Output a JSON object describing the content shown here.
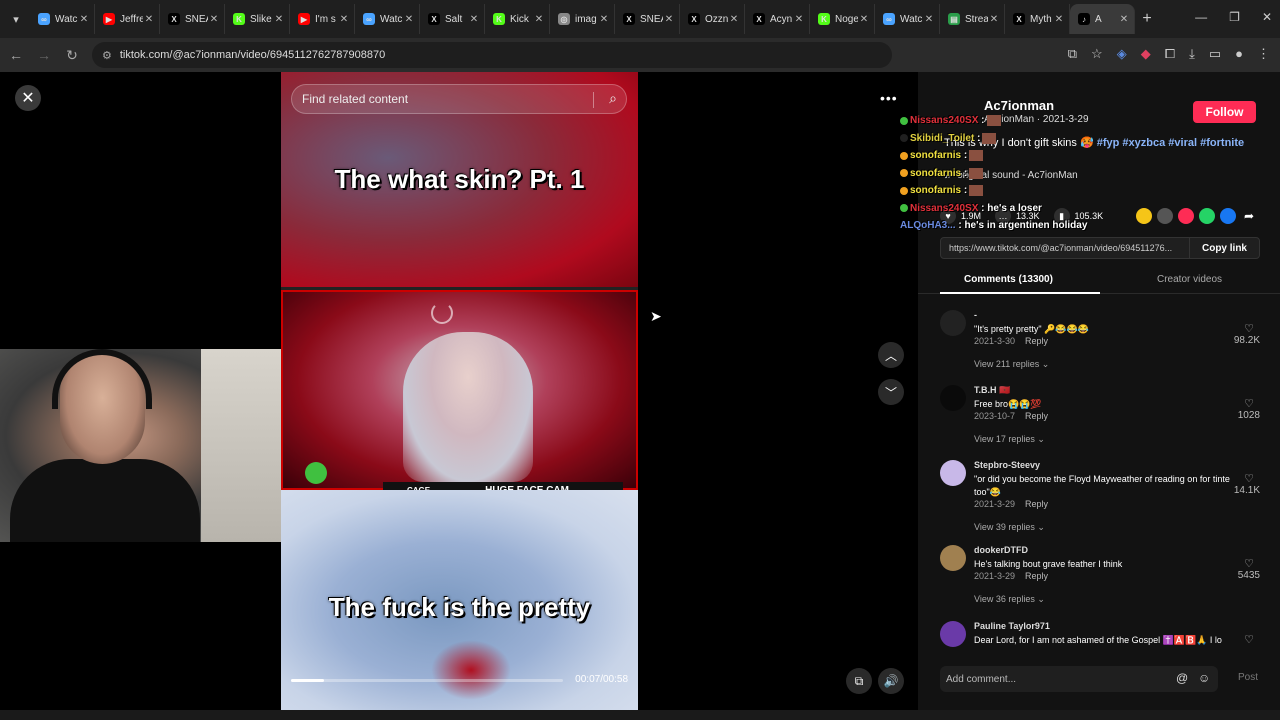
{
  "browser": {
    "tabs": [
      {
        "label": "Watc",
        "fav_color": "#4aa3ff",
        "fav_glyph": "∞"
      },
      {
        "label": "Jeffre",
        "fav_color": "#ff0000",
        "fav_glyph": "▶"
      },
      {
        "label": "SNEA",
        "fav_color": "#000000",
        "fav_glyph": "X"
      },
      {
        "label": "Slike",
        "fav_color": "#53fc18",
        "fav_glyph": "K"
      },
      {
        "label": "I'm s",
        "fav_color": "#ff0000",
        "fav_glyph": "▶"
      },
      {
        "label": "Watc",
        "fav_color": "#4aa3ff",
        "fav_glyph": "∞"
      },
      {
        "label": "Salt",
        "fav_color": "#000000",
        "fav_glyph": "X"
      },
      {
        "label": "Kick",
        "fav_color": "#53fc18",
        "fav_glyph": "K"
      },
      {
        "label": "imag",
        "fav_color": "#888888",
        "fav_glyph": "◎"
      },
      {
        "label": "SNEA",
        "fav_color": "#000000",
        "fav_glyph": "X"
      },
      {
        "label": "Ozzn",
        "fav_color": "#000000",
        "fav_glyph": "X"
      },
      {
        "label": "Acyn",
        "fav_color": "#000000",
        "fav_glyph": "X"
      },
      {
        "label": "Noge",
        "fav_color": "#53fc18",
        "fav_glyph": "K"
      },
      {
        "label": "Watc",
        "fav_color": "#4aa3ff",
        "fav_glyph": "∞"
      },
      {
        "label": "Strea",
        "fav_color": "#2a9d4a",
        "fav_glyph": "▤"
      },
      {
        "label": "Myth",
        "fav_color": "#000000",
        "fav_glyph": "X"
      },
      {
        "label": "A",
        "fav_color": "#000000",
        "fav_glyph": "♪"
      }
    ],
    "url": "tiktok.com/@ac7ionman/video/6945112762787908870"
  },
  "video": {
    "search_placeholder": "Find related content",
    "caption_top": "The what skin? Pt. 1",
    "caption_bottom": "The fuck is the pretty",
    "facecam_label": "HUGE FACE CAM",
    "cage_label": "CAGE",
    "time": "00:07/00:58",
    "progress": 0.12
  },
  "panel": {
    "author_name": "Ac7ionman",
    "author_sub": "Ac7ionMan · 2021-3-29",
    "follow_label": "Follow",
    "desc_text": "This is why I don't gift skins 🥵",
    "desc_tags": [
      "#fyp",
      "#xyzbca",
      "#viral",
      "#fortnite"
    ],
    "sound": "original sound - Ac7ionMan",
    "stats": {
      "likes": "1.9M",
      "comments": "13.3K",
      "saves": "105.3K"
    },
    "share_colors": [
      "#f5c518",
      "#555555",
      "#fe2c55",
      "#25d366",
      "#1877f2"
    ],
    "link": "https://www.tiktok.com/@ac7ionman/video/694511276...",
    "copy_label": "Copy link",
    "tab_comments": "Comments (13300)",
    "tab_creator": "Creator videos",
    "comments": [
      {
        "user": "-",
        "text": "\"It's pretty pretty\" 🔑😂😂😂",
        "date": "2021-3-30",
        "reply": "Reply",
        "replies": "View 211 replies",
        "likes": "98.2K",
        "avatar": "#222222"
      },
      {
        "user": "T.B.H 🇲🇦",
        "text": "Free bro😭😭💯",
        "date": "2023-10-7",
        "reply": "Reply",
        "replies": "View 17 replies",
        "likes": "1028",
        "avatar": "#0a0a0a"
      },
      {
        "user": "Stepbro-Steevy",
        "text": "\"or did you become the Floyd Mayweather of reading on for tinte too\"😂",
        "date": "2021-3-29",
        "reply": "Reply",
        "replies": "View 39 replies",
        "likes": "14.1K",
        "avatar": "#c8b8e8"
      },
      {
        "user": "dookerDTFD",
        "text": "He's talking bout grave feather I think",
        "date": "2021-3-29",
        "reply": "Reply",
        "replies": "View 36 replies",
        "likes": "5435",
        "avatar": "#a08050"
      },
      {
        "user": "Pauline Taylor971",
        "text": "Dear Lord, for I am not ashamed of the Gospel ✝️🅰️🅱️🙏 I lo",
        "date": "",
        "reply": "",
        "replies": "",
        "likes": "",
        "avatar": "#6a3aa8"
      }
    ],
    "add_comment_placeholder": "Add comment...",
    "post_label": "Post"
  },
  "chat": [
    {
      "user": "Nissans240SX",
      "sep": ":",
      "color": "#e0303a",
      "badge": "#40c040"
    },
    {
      "user": "Skibidi_Toilet",
      "sep": ":",
      "color": "#e0d040",
      "badge": "#202020"
    },
    {
      "user": "sonofarnis",
      "sep": ":",
      "color": "#f0e040",
      "badge": "#f0a020"
    },
    {
      "user": "sonofarnis",
      "sep": ":",
      "color": "#f0e040",
      "badge": "#f0a020"
    },
    {
      "user": "sonofarnis",
      "sep": ":",
      "color": "#f0e040",
      "badge": "#f0a020"
    },
    {
      "user": "Nissans240SX",
      "sep": ": he's a loser",
      "color": "#e0303a",
      "badge": "#40c040"
    },
    {
      "user": "ALQoHA3...",
      "sep": ": he's in argentinen holiday",
      "color": "#6a8ae0",
      "badge": ""
    }
  ]
}
